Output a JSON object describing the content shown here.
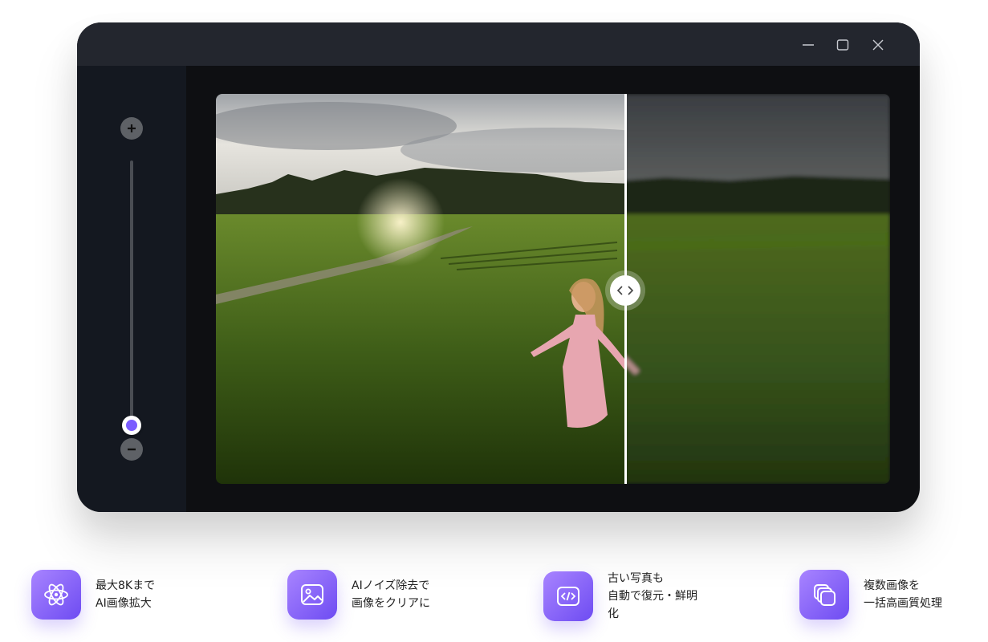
{
  "window": {
    "controls": {
      "minimize_icon": "minimize-icon",
      "maximize_icon": "maximize-icon",
      "close_icon": "close-icon"
    }
  },
  "zoom": {
    "zoom_in_icon": "plus-icon",
    "zoom_out_icon": "minus-icon",
    "level_fraction": 0.0,
    "accent_color": "#7a5cff"
  },
  "compare": {
    "split_fraction": 0.607,
    "handle_icon": "chevrons-left-right-icon"
  },
  "features": [
    {
      "icon": "atom-icon",
      "line1": "最大8Kまで",
      "line2": "AI画像拡大",
      "line3": ""
    },
    {
      "icon": "image-icon",
      "line1": "AIノイズ除去で",
      "line2": "画像をクリアに",
      "line3": ""
    },
    {
      "icon": "code-icon",
      "line1": "古い写真も",
      "line2": "自動で復元・鮮明",
      "line3": "化"
    },
    {
      "icon": "copy-icon",
      "line1": "複数画像を",
      "line2": "一括高画質処理",
      "line3": ""
    }
  ],
  "colors": {
    "icon_gradient_start": "#a884ff",
    "icon_gradient_end": "#6e4cf2"
  }
}
